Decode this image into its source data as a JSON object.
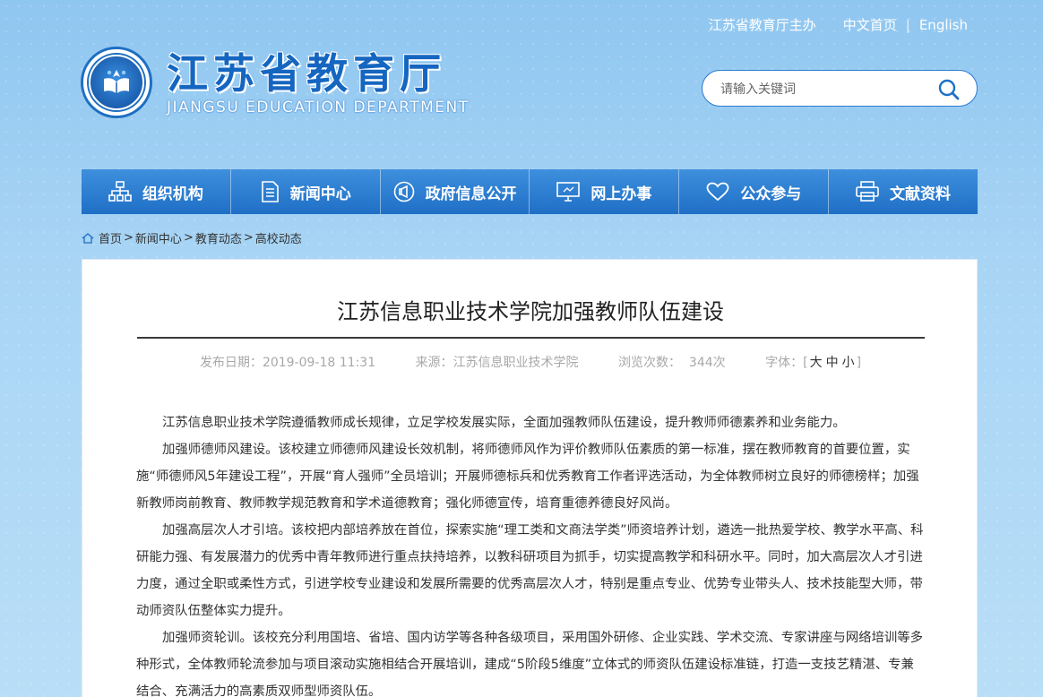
{
  "header": {
    "sponsor": "江苏省教育厅主办",
    "home_cn": "中文首页",
    "separator": "|",
    "english": "English",
    "logo_cn": "江苏省教育厅",
    "logo_en": "JIANGSU EDUCATION DEPARTMENT"
  },
  "search": {
    "placeholder": "请输入关键词",
    "icon": "search-icon"
  },
  "nav": {
    "items": [
      {
        "label": "组织机构",
        "icon": "org-chart-icon"
      },
      {
        "label": "新闻中心",
        "icon": "document-icon"
      },
      {
        "label": "政府信息公开",
        "icon": "announcement-icon"
      },
      {
        "label": "网上办事",
        "icon": "monitor-icon"
      },
      {
        "label": "公众参与",
        "icon": "heart-icon"
      },
      {
        "label": "文献资料",
        "icon": "printer-icon"
      }
    ]
  },
  "breadcrumb": {
    "home": "首页",
    "news": "新闻中心",
    "edu": "教育动态",
    "college": "高校动态",
    "sep": ">"
  },
  "article": {
    "title": "江苏信息职业技术学院加强教师队伍建设",
    "publish_label": "发布日期：",
    "publish_date": "2019-09-18 11:31",
    "source_label": "来源：",
    "source": "江苏信息职业技术学院",
    "views_label": "浏览次数：",
    "views": "344次",
    "font_label": "字体：",
    "font_open": "[",
    "font_large": "大",
    "font_medium": "中",
    "font_small": "小",
    "font_close": "]",
    "paragraphs": [
      "江苏信息职业技术学院遵循教师成长规律，立足学校发展实际，全面加强教师队伍建设，提升教师师德素养和业务能力。",
      "加强师德师风建设。该校建立师德师风建设长效机制，将师德师风作为评价教师队伍素质的第一标准，摆在教师教育的首要位置，实施“师德师风5年建设工程”，开展“育人强师”全员培训；开展师德标兵和优秀教育工作者评选活动，为全体教师树立良好的师德榜样；加强新教师岗前教育、教师教学规范教育和学术道德教育；强化师德宣传，培育重德养德良好风尚。",
      "加强高层次人才引培。该校把内部培养放在首位，探索实施“理工类和文商法学类”师资培养计划，遴选一批热爱学校、教学水平高、科研能力强、有发展潜力的优秀中青年教师进行重点扶持培养，以教科研项目为抓手，切实提高教学和科研水平。同时，加大高层次人才引进力度，通过全职或柔性方式，引进学校专业建设和发展所需要的优秀高层次人才，特别是重点专业、优势专业带头人、技术技能型大师，带动师资队伍整体实力提升。",
      "加强师资轮训。该校充分利用国培、省培、国内访学等各种各级项目，采用国外研修、企业实践、学术交流、专家讲座与网络培训等多种形式，全体教师轮流参加与项目滚动实施相结合开展培训，建成“5阶段5维度”立体式的师资队伍建设标准链，打造一支技艺精湛、专兼结合、充满活力的高素质双师型师资队伍。"
    ]
  }
}
